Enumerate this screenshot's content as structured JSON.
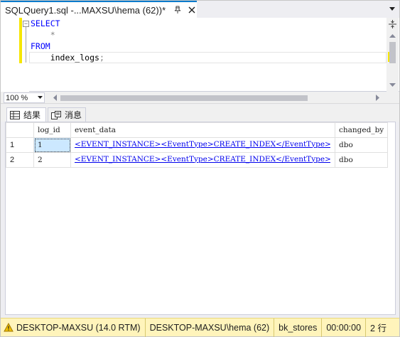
{
  "tab": {
    "title": "SQLQuery1.sql -...MAXSU\\hema (62))*"
  },
  "editor": {
    "lines": [
      {
        "parts": [
          {
            "cls": "kw",
            "text": "SELECT"
          }
        ]
      },
      {
        "parts": [
          {
            "cls": "op",
            "text": "    *"
          }
        ]
      },
      {
        "parts": [
          {
            "cls": "kw",
            "text": "FROM"
          }
        ]
      },
      {
        "parts": [
          {
            "cls": "plain",
            "text": "    index_logs"
          },
          {
            "cls": "op",
            "text": ";"
          }
        ]
      }
    ]
  },
  "zoom": {
    "value": "100 %"
  },
  "results_tabs": {
    "results_label": "结果",
    "messages_label": "消息"
  },
  "grid": {
    "columns": [
      "",
      "log_id",
      "event_data",
      "changed_by"
    ],
    "rows": [
      {
        "rownum": "1",
        "log_id": "1",
        "event_data": "<EVENT_INSTANCE><EventType>CREATE_INDEX</EventType><Post...",
        "changed_by": "dbo"
      },
      {
        "rownum": "2",
        "log_id": "2",
        "event_data": "<EVENT_INSTANCE><EventType>CREATE_INDEX</EventType><Post...",
        "changed_by": "dbo"
      }
    ]
  },
  "status": {
    "server": "DESKTOP-MAXSU (14.0 RTM)",
    "user": "DESKTOP-MAXSU\\hema (62)",
    "database": "bk_stores",
    "elapsed": "00:00:00",
    "rows": "2 行"
  },
  "colors": {
    "accent": "#007acc",
    "status_bg": "#fff4bb",
    "keyword": "#0000ff",
    "selection": "#cce8ff"
  }
}
